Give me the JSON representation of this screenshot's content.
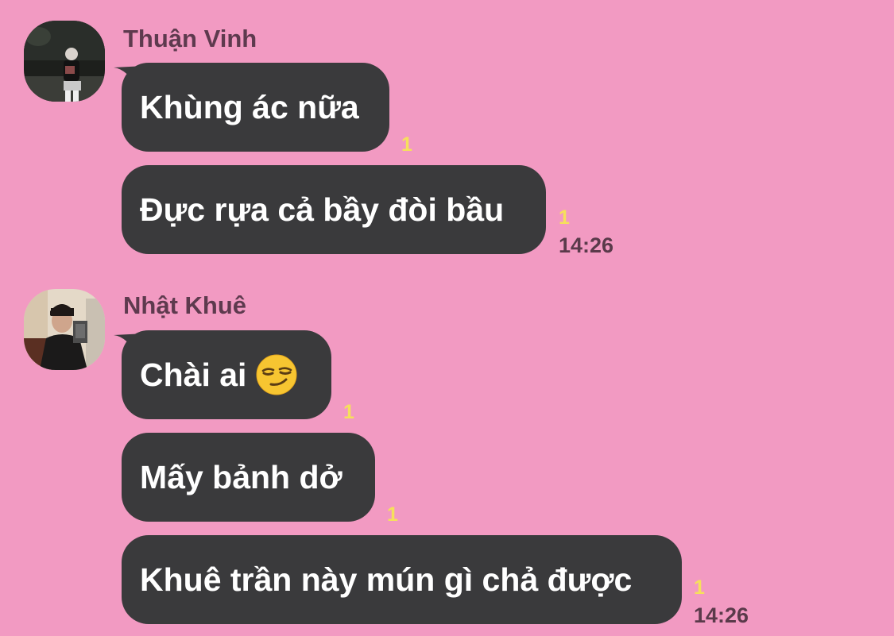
{
  "groups": [
    {
      "sender": "Thuận Vinh",
      "messages": [
        {
          "text": "Khùng ác nữa",
          "unread": "1"
        },
        {
          "text": "Đực rựa cả bầy đòi bầu",
          "unread": "1",
          "time": "14:26"
        }
      ]
    },
    {
      "sender": "Nhật Khuê",
      "messages": [
        {
          "text": "Chài ai",
          "emoji": "smirking-face",
          "unread": "1"
        },
        {
          "text": "Mấy bảnh dở",
          "unread": "1"
        },
        {
          "text": "Khuê trần này mún gì chả được",
          "unread": "1",
          "time": "14:26"
        }
      ]
    }
  ],
  "colors": {
    "background": "#f29ac2",
    "bubble": "#3a3a3c",
    "bubble_text": "#ffffff",
    "unread": "#f6e05b",
    "name": "#5e3a4e"
  }
}
